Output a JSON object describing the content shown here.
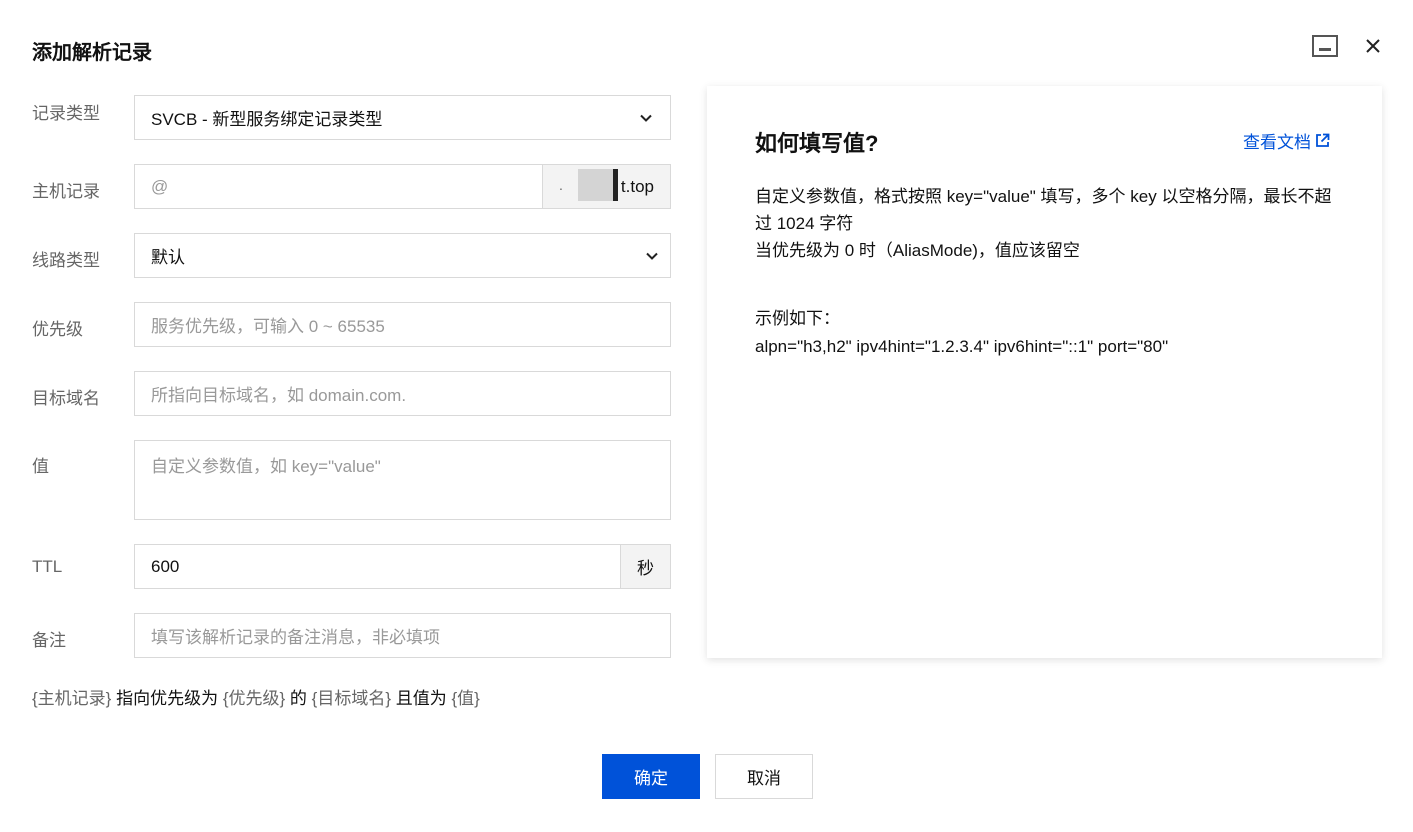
{
  "dialog": {
    "title": "添加解析记录"
  },
  "form": {
    "record_type": {
      "label": "记录类型",
      "value": "SVCB - 新型服务绑定记录类型"
    },
    "host": {
      "label": "主机记录",
      "placeholder": "@",
      "suffix_dot": ".",
      "suffix_visible": "t.top"
    },
    "line_type": {
      "label": "线路类型",
      "value": "默认"
    },
    "priority": {
      "label": "优先级",
      "placeholder": "服务优先级，可输入 0 ~ 65535"
    },
    "target": {
      "label": "目标域名",
      "placeholder": "所指向目标域名，如 domain.com."
    },
    "value": {
      "label": "值",
      "placeholder": "自定义参数值，如 key=\"value\""
    },
    "ttl": {
      "label": "TTL",
      "value": "600",
      "unit": "秒"
    },
    "remark": {
      "label": "备注",
      "placeholder": "填写该解析记录的备注消息，非必填项"
    }
  },
  "summary": {
    "host_token": "{主机记录}",
    "text1": "指向优先级为",
    "priority_token": "{优先级}",
    "text2": "的",
    "target_token": "{目标域名}",
    "text3": "且值为",
    "value_token": "{值}"
  },
  "help": {
    "title": "如何填写值?",
    "doc_link": "查看文档",
    "desc_line1": "自定义参数值，格式按照 key=\"value\" 填写，多个 key 以空格分隔，最长不超过 1024 字符",
    "desc_line2": "当优先级为 0 时（AliasMode)，值应该留空",
    "example_label": "示例如下：",
    "example_code": "alpn=\"h3,h2\" ipv4hint=\"1.2.3.4\" ipv6hint=\"::1\" port=\"80\""
  },
  "buttons": {
    "confirm": "确定",
    "cancel": "取消"
  },
  "colors": {
    "primary": "#0052d9",
    "link": "#0052d9"
  },
  "icons": {
    "minimize": "minimize-icon",
    "close": "close-icon",
    "select_arrow": "chevron-down-icon",
    "external_link": "external-link-icon"
  }
}
